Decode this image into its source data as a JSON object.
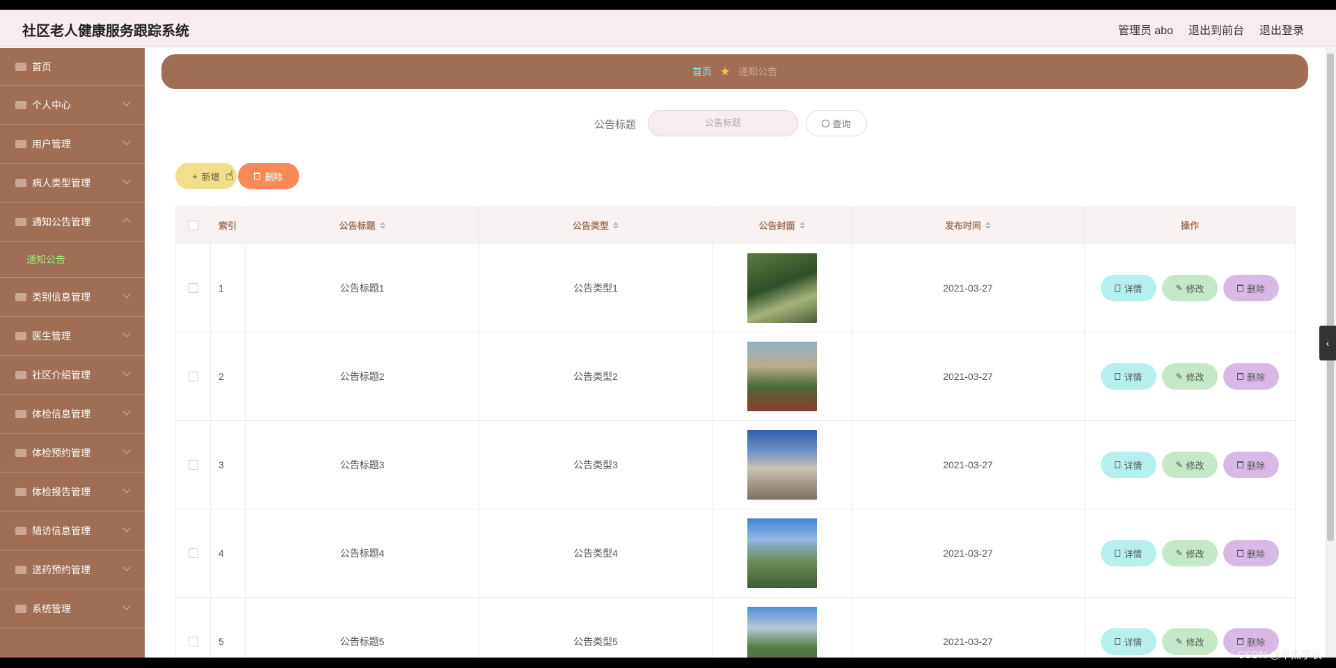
{
  "header": {
    "title": "社区老人健康服务跟踪系统",
    "links": [
      "管理员 abo",
      "退出到前台",
      "退出登录"
    ]
  },
  "sidebar": {
    "items": [
      {
        "label": "首页",
        "icon": "home-icon"
      },
      {
        "label": "个人中心",
        "icon": "user-icon"
      },
      {
        "label": "用户管理",
        "icon": "users-icon"
      },
      {
        "label": "病人类型管理",
        "icon": "monitor-icon"
      },
      {
        "label": "通知公告管理",
        "icon": "fullscreen-icon",
        "expanded": true
      },
      {
        "label": "类别信息管理",
        "icon": "grid-icon"
      },
      {
        "label": "医生管理",
        "icon": "doctor-icon"
      },
      {
        "label": "社区介绍管理",
        "icon": "compass-icon"
      },
      {
        "label": "体检信息管理",
        "icon": "crop-icon"
      },
      {
        "label": "体检预约管理",
        "icon": "flag-icon"
      },
      {
        "label": "体检报告管理",
        "icon": "report-icon"
      },
      {
        "label": "随访信息管理",
        "icon": "send-icon"
      },
      {
        "label": "送药预约管理",
        "icon": "power-icon"
      },
      {
        "label": "系统管理",
        "icon": "settings-icon"
      }
    ],
    "sub_item": "通知公告"
  },
  "breadcrumb": {
    "home": "首页",
    "current": "通知公告"
  },
  "search": {
    "label": "公告标题",
    "placeholder": "公告标题",
    "button": "查询"
  },
  "toolbar": {
    "add": "新增",
    "delete": "删除"
  },
  "table": {
    "headers": [
      "索引",
      "公告标题",
      "公告类型",
      "公告封面",
      "发布时间",
      "操作"
    ],
    "actions": {
      "detail": "详情",
      "edit": "修改",
      "delete": "删除"
    },
    "rows": [
      {
        "index": "1",
        "title": "公告标题1",
        "type": "公告类型1",
        "time": "2021-03-27"
      },
      {
        "index": "2",
        "title": "公告标题2",
        "type": "公告类型2",
        "time": "2021-03-27"
      },
      {
        "index": "3",
        "title": "公告标题3",
        "type": "公告类型3",
        "time": "2021-03-27"
      },
      {
        "index": "4",
        "title": "公告标题4",
        "type": "公告类型4",
        "time": "2021-03-27"
      },
      {
        "index": "5",
        "title": "公告标题5",
        "type": "公告类型5",
        "time": "2021-03-27"
      }
    ]
  },
  "watermark": "CSDN @卓杰学长",
  "colors": {
    "sidebar": "#9f6e55",
    "header": "#f7ecee",
    "accent_green": "#9ef07a"
  }
}
